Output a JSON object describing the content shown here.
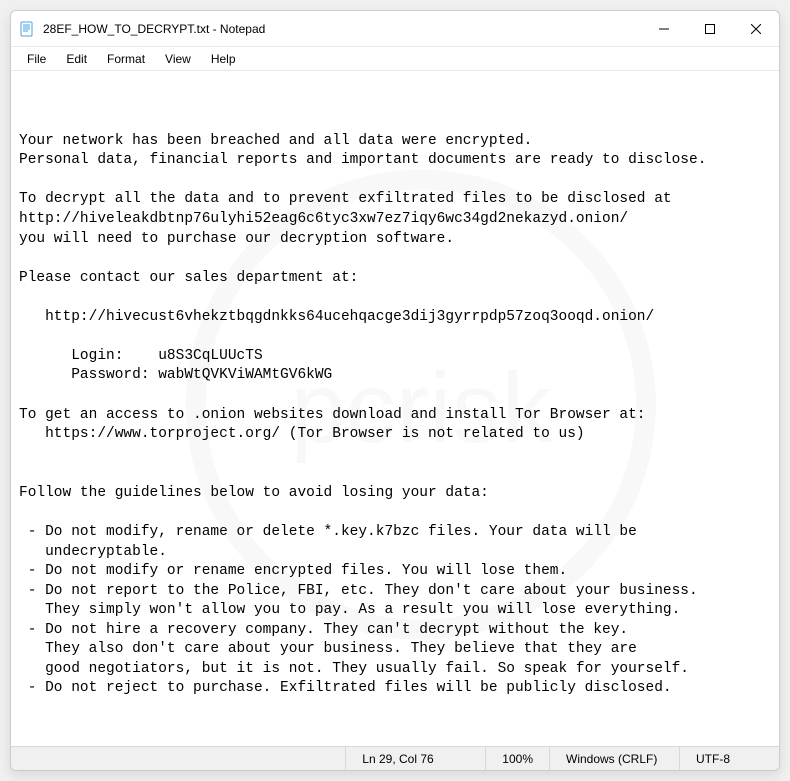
{
  "window": {
    "title": "28EF_HOW_TO_DECRYPT.txt - Notepad"
  },
  "menu": {
    "file": "File",
    "edit": "Edit",
    "format": "Format",
    "view": "View",
    "help": "Help"
  },
  "body": {
    "text": "Your network has been breached and all data were encrypted.\nPersonal data, financial reports and important documents are ready to disclose.\n\nTo decrypt all the data and to prevent exfiltrated files to be disclosed at\nhttp://hiveleakdbtnp76ulyhi52eag6c6tyc3xw7ez7iqy6wc34gd2nekazyd.onion/\nyou will need to purchase our decryption software.\n\nPlease contact our sales department at:\n\n   http://hivecust6vhekztbqgdnkks64ucehqacge3dij3gyrrpdp57zoq3ooqd.onion/\n\n      Login:    u8S3CqLUUcTS\n      Password: wabWtQVKViWAMtGV6kWG\n\nTo get an access to .onion websites download and install Tor Browser at:\n   https://www.torproject.org/ (Tor Browser is not related to us)\n\n\nFollow the guidelines below to avoid losing your data:\n\n - Do not modify, rename or delete *.key.k7bzc files. Your data will be\n   undecryptable.\n - Do not modify or rename encrypted files. You will lose them.\n - Do not report to the Police, FBI, etc. They don't care about your business.\n   They simply won't allow you to pay. As a result you will lose everything.\n - Do not hire a recovery company. They can't decrypt without the key.\n   They also don't care about your business. They believe that they are\n   good negotiators, but it is not. They usually fail. So speak for yourself.\n - Do not reject to purchase. Exfiltrated files will be publicly disclosed."
  },
  "statusbar": {
    "position": "Ln 29, Col 76",
    "zoom": "100%",
    "line_ending": "Windows (CRLF)",
    "encoding": "UTF-8"
  }
}
